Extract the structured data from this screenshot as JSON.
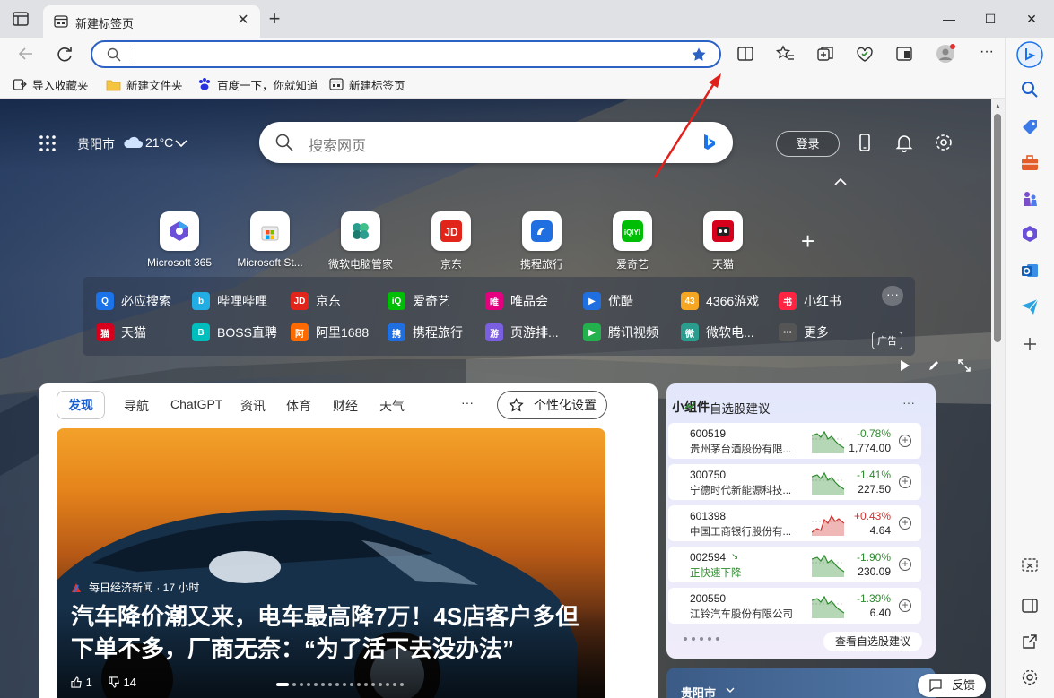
{
  "tab": {
    "title": "新建标签页",
    "close": "✕"
  },
  "window": {
    "new_tab": "+",
    "minimize": "—",
    "maximize": "☐",
    "close": "✕"
  },
  "bookmarks": [
    {
      "label": "导入收藏夹",
      "icon": "import-icon"
    },
    {
      "label": "新建文件夹",
      "icon": "folder-icon"
    },
    {
      "label": "百度一下，你就知道",
      "icon": "baidu-icon"
    },
    {
      "label": "新建标签页",
      "icon": "newtab-icon"
    }
  ],
  "header": {
    "city": "贵阳市",
    "temperature": "21°C",
    "search_placeholder": "搜索网页",
    "login": "登录"
  },
  "quick_links": [
    {
      "label": "Microsoft 365",
      "color": "#6a4fd8"
    },
    {
      "label": "Microsoft St...",
      "color": "#e9e9e9"
    },
    {
      "label": "微软电脑管家",
      "color": "#2a9d8f"
    },
    {
      "label": "京东",
      "color": "#e1251b"
    },
    {
      "label": "携程旅行",
      "color": "#1f6fe0"
    },
    {
      "label": "爱奇艺",
      "color": "#00be06"
    },
    {
      "label": "天猫",
      "color": "#d6001c"
    }
  ],
  "sites_row1": [
    {
      "label": "必应搜索",
      "color": "#1a73e8",
      "glyph": "Q"
    },
    {
      "label": "哔哩哔哩",
      "color": "#23ade5",
      "glyph": "b"
    },
    {
      "label": "京东",
      "color": "#e1251b",
      "glyph": "JD"
    },
    {
      "label": "爱奇艺",
      "color": "#00be06",
      "glyph": "iQ"
    },
    {
      "label": "唯品会",
      "color": "#e4007f",
      "glyph": "唯"
    },
    {
      "label": "优酷",
      "color": "#1f6fe0",
      "glyph": "▶"
    },
    {
      "label": "4366游戏",
      "color": "#f5a623",
      "glyph": "43"
    },
    {
      "label": "小红书",
      "color": "#ff2442",
      "glyph": "书"
    }
  ],
  "sites_row2": [
    {
      "label": "天猫",
      "color": "#d6001c",
      "glyph": "猫"
    },
    {
      "label": "BOSS直聘",
      "color": "#00bebd",
      "glyph": "B"
    },
    {
      "label": "阿里1688",
      "color": "#ff6a00",
      "glyph": "阿"
    },
    {
      "label": "携程旅行",
      "color": "#1f6fe0",
      "glyph": "携"
    },
    {
      "label": "页游排...",
      "color": "#7a5fe0",
      "glyph": "游"
    },
    {
      "label": "腾讯视频",
      "color": "#22b14c",
      "glyph": "▶"
    },
    {
      "label": "微软电...",
      "color": "#2a9d8f",
      "glyph": "微"
    },
    {
      "label": "更多",
      "color": "#555555",
      "glyph": "⋯"
    }
  ],
  "site_more": "···",
  "ad_tag": "广告",
  "feed": {
    "tabs": [
      "发现",
      "导航",
      "ChatGPT",
      "资讯",
      "体育",
      "财经",
      "天气"
    ],
    "more": "···",
    "personalize": "个性化设置",
    "hero": {
      "source": "每日经济新闻 · 17 小时",
      "headline": "汽车降价潮又来，电车最高降7万！4S店客户多但下单不多，厂商无奈：“为了活下去没办法”",
      "likes": "1",
      "dislikes": "14"
    }
  },
  "stocks": {
    "title": "小组件",
    "subtitle": "自选股建议",
    "menu": "···",
    "rows": [
      {
        "code": "600519",
        "name": "贵州茅台酒股份有限...",
        "pct": "-0.78%",
        "price": "1,774.00",
        "trend": "down"
      },
      {
        "code": "300750",
        "name": "宁德时代新能源科技...",
        "pct": "-1.41%",
        "price": "227.50",
        "trend": "down"
      },
      {
        "code": "601398",
        "name": "中国工商银行股份有...",
        "pct": "+0.43%",
        "price": "4.64",
        "trend": "up"
      },
      {
        "code": "002594",
        "name": "正快速下降",
        "pct": "-1.90%",
        "price": "230.09",
        "trend": "down",
        "alert": true
      },
      {
        "code": "200550",
        "name": "江铃汽车股份有限公司",
        "pct": "-1.39%",
        "price": "6.40",
        "trend": "down"
      }
    ],
    "view_all": "查看自选股建议"
  },
  "weather_card": {
    "city": "贵阳市"
  },
  "feedback": "反馈",
  "colors": {
    "accent": "#2b62c4",
    "down": "#2e8b2e",
    "up": "#d0302e"
  }
}
